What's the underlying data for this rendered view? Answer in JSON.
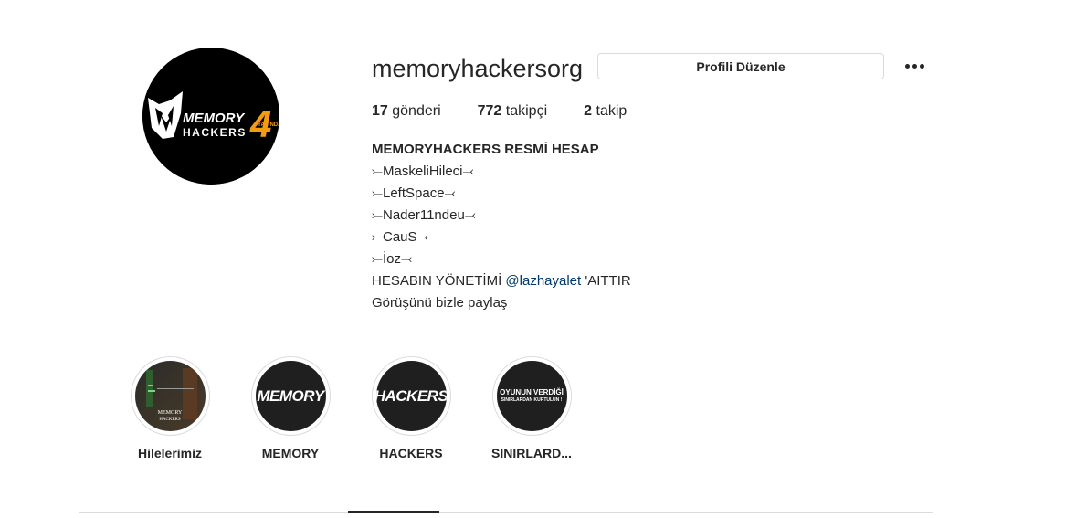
{
  "profile": {
    "username": "memoryhackersorg",
    "edit_button": "Profili Düzenle",
    "more_icon": "ellipsis-icon",
    "avatar_logo_text": "MEMORY HACKERS 4 YAŞINDA"
  },
  "stats": {
    "posts_count": "17",
    "posts_label": "gönderi",
    "followers_count": "772",
    "followers_label": "takipçi",
    "following_count": "2",
    "following_label": "takip"
  },
  "bio": {
    "full_name": "MEMORYHACKERS RESMİ HESAP",
    "lines": [
      "⤚MaskeliHileci⤙",
      "⤚LeftSpace⤙",
      "⤚Nader11ndeu⤙",
      "⤚CauS⤙",
      "⤚İoz⤙"
    ],
    "management_prefix": "HESABIN YÖNETİMİ ",
    "management_mention": "@lazhayalet",
    "management_suffix": " 'AITTIR",
    "last_line": "Görüşünü bizle paylaş"
  },
  "highlights": [
    {
      "label": "Hilelerimiz",
      "cover_text": "MEMORY HACKERS"
    },
    {
      "label": "MEMORY",
      "cover_text": "MEMORY"
    },
    {
      "label": "HACKERS",
      "cover_text": "HACKERS"
    },
    {
      "label": "SINIRLARD...",
      "cover_text": "OYUNUN VERDİĞİ",
      "cover_subtext": "SINIRLARDAN KURTULUN !"
    }
  ],
  "colors": {
    "text": "#262626",
    "mention": "#00376b",
    "border": "#dbdbdb",
    "accent_orange": "#f39c12"
  }
}
